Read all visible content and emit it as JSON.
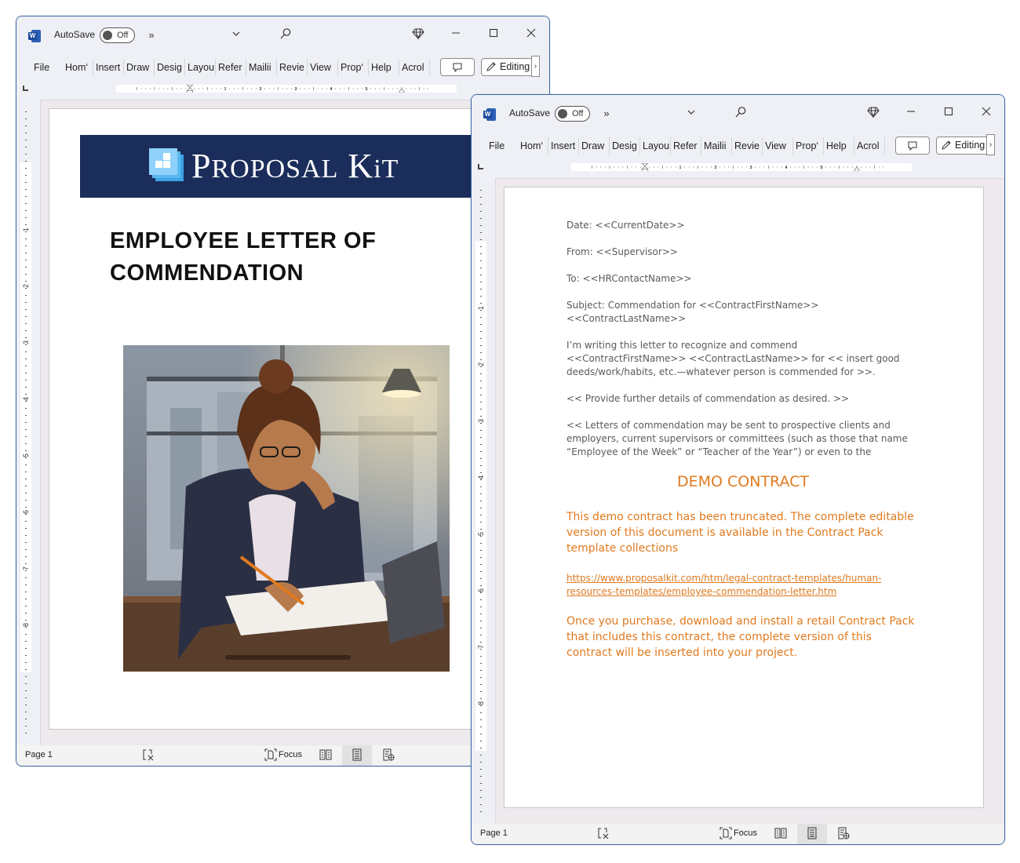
{
  "windows": [
    {
      "id": "left",
      "titlebar": {
        "app_icon": "word-icon",
        "autosave_label": "AutoSave",
        "autosave_state": "Off",
        "overflow_label": "»",
        "icons": [
          "chevron-down-icon",
          "search-icon",
          "diamond-icon",
          "minimize-icon",
          "maximize-icon",
          "close-icon"
        ]
      },
      "ribbon": {
        "tabs": [
          "File",
          "Hom‘",
          "Insert",
          "Draw",
          "Desig",
          "Layou",
          "Refer",
          "Mailii",
          "Revie",
          "View",
          "Prop‘",
          "Help",
          "Acrol"
        ],
        "comment_icon": "comment-icon",
        "editing_label": "Editing",
        "more_label": "›"
      },
      "ruler": {
        "h_numbers": [
          "1",
          "2",
          "3",
          "4",
          "5"
        ],
        "v_numbers": [
          "1",
          "2",
          "3",
          "4",
          "5",
          "6",
          "7",
          "8"
        ]
      },
      "document": {
        "brand": {
          "name_big1": "P",
          "name_small1": "ROPOSAL",
          "name_big2": "K",
          "name_small2": "i",
          "name_small3": "T",
          "full": "Proposal Kit",
          "banner_color": "#1b2d5a"
        },
        "title": "EMPLOYEE LETTER OF COMMENDATION",
        "image_alt": "Illustration of a businesswoman writing at a desk"
      },
      "status": {
        "page": "Page 1",
        "focus_label": "Focus"
      }
    },
    {
      "id": "right",
      "titlebar": {
        "app_icon": "word-icon",
        "autosave_label": "AutoSave",
        "autosave_state": "Off",
        "overflow_label": "»"
      },
      "ribbon": {
        "tabs": [
          "File",
          "Hom‘",
          "Insert",
          "Draw",
          "Desig",
          "Layou",
          "Refer",
          "Mailii",
          "Revie",
          "View",
          "Prop‘",
          "Help",
          "Acrol"
        ],
        "editing_label": "Editing",
        "more_label": "›"
      },
      "ruler": {
        "h_numbers": [
          "1",
          "2",
          "3",
          "4",
          "5"
        ],
        "v_numbers": [
          "1",
          "2",
          "3",
          "4",
          "5",
          "6",
          "7",
          "8"
        ]
      },
      "document": {
        "lines": [
          "Date: <<CurrentDate>>",
          "From: <<Supervisor>>",
          "To: <<HRContactName>>",
          "Subject: Commendation for <<ContractFirstName>> <<ContractLastName>>",
          "I’m writing this letter to recognize and commend <<ContractFirstName>> <<ContractLastName>> for << insert good deeds/work/habits, etc.—whatever person is commended for >>.",
          "<< Provide further details of commendation as desired. >>",
          "<< Letters of commendation may be sent to prospective clients and employers, current supervisors or committees (such as those that name “Employee of the Week” or “Teacher of the Year”) or even to the"
        ],
        "demo_title": "DEMO CONTRACT",
        "demo_text1": "This demo contract has been truncated. The complete editable version of this document is available in the Contract Pack template collections",
        "demo_link": "https://www.proposalkit.com/htm/legal-contract-templates/human-resources-templates/employee-commendation-letter.htm",
        "demo_text2": "Once you purchase, download and install a retail Contract Pack that includes this contract, the complete version of this contract will be inserted into your project.",
        "accent_color": "#e07a1f"
      },
      "status": {
        "page": "Page 1",
        "focus_label": "Focus"
      }
    }
  ]
}
